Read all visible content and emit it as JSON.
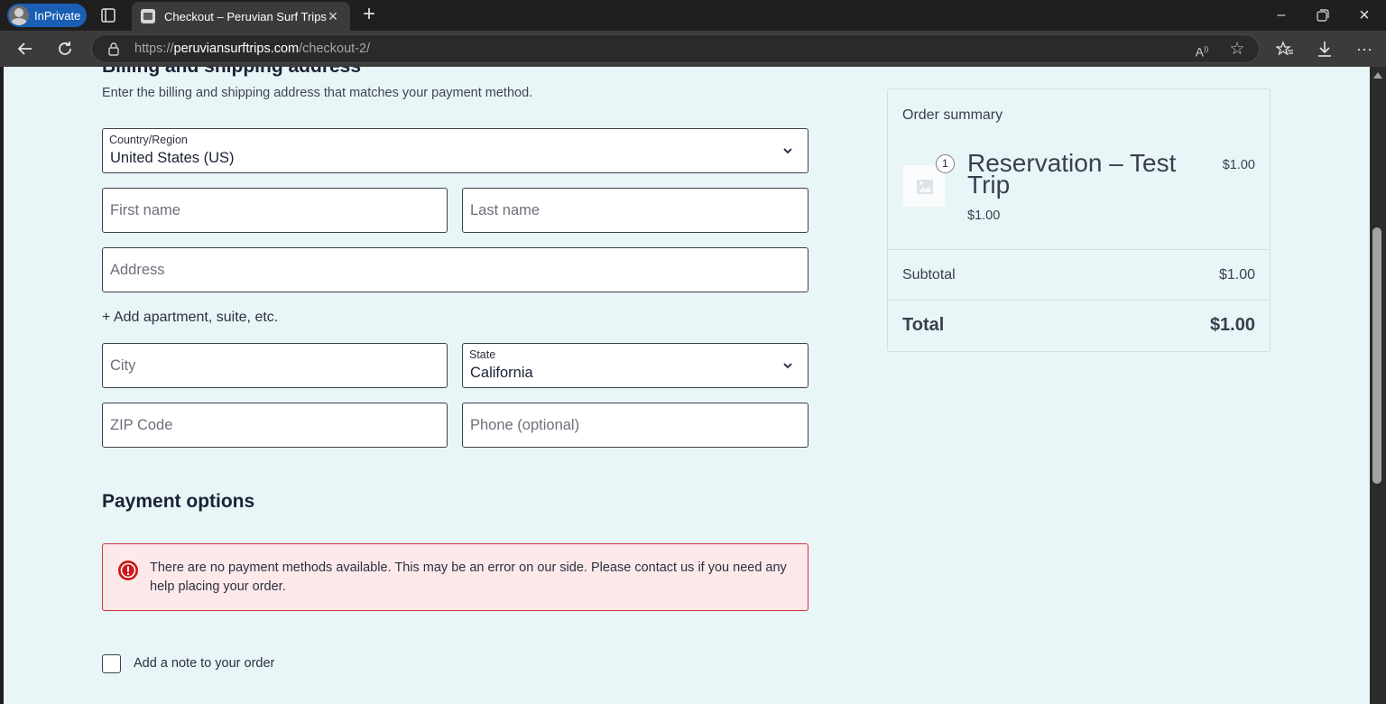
{
  "browser": {
    "profile_label": "InPrivate",
    "tab_title": "Checkout – Peruvian Surf Trips",
    "url_prefix": "https://",
    "url_host": "peruviansurftrips.com",
    "url_path": "/checkout-2/"
  },
  "billing": {
    "title": "Billing and shipping address",
    "description": "Enter the billing and shipping address that matches your payment method.",
    "country_label": "Country/Region",
    "country_value": "United States (US)",
    "first_name_placeholder": "First name",
    "last_name_placeholder": "Last name",
    "address_placeholder": "Address",
    "add_apartment": "+ Add apartment, suite, etc.",
    "city_placeholder": "City",
    "state_label": "State",
    "state_value": "California",
    "zip_placeholder": "ZIP Code",
    "phone_placeholder": "Phone (optional)"
  },
  "payment": {
    "title": "Payment options",
    "error_message": "There are no payment methods available. This may be an error on our side. Please contact us if you need any help placing your order.",
    "error_color": "#d3313f"
  },
  "note": {
    "label": "Add a note to your order",
    "checked": false
  },
  "summary": {
    "title": "Order summary",
    "item_quantity": "1",
    "item_name": "Reservation – Test Trip",
    "item_total": "$1.00",
    "item_price": "$1.00",
    "subtotal_label": "Subtotal",
    "subtotal_value": "$1.00",
    "total_label": "Total",
    "total_value": "$1.00"
  },
  "colors": {
    "page_background": "#e9f6f7",
    "inprivate_badge": "#1a5fb4"
  }
}
